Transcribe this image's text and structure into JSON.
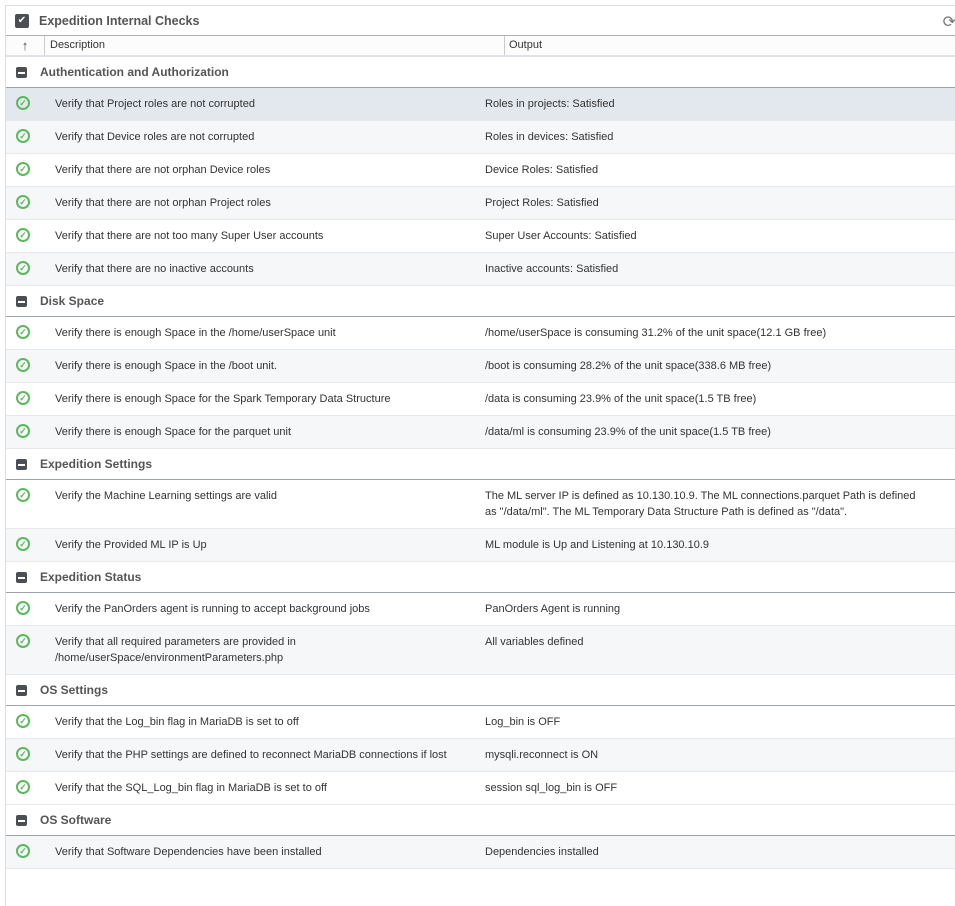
{
  "title": "Expedition Internal Checks",
  "columns": {
    "sort": "↑",
    "description": "Description",
    "output": "Output"
  },
  "groups": [
    {
      "name": "Authentication and Authorization",
      "rows": [
        {
          "description": "Verify that Project roles are not corrupted",
          "output": "Roles in projects: Satisfied"
        },
        {
          "description": "Verify that Device roles are not corrupted",
          "output": "Roles in devices: Satisfied"
        },
        {
          "description": "Verify that there are not orphan Device roles",
          "output": "Device Roles: Satisfied"
        },
        {
          "description": "Verify that there are not orphan Project roles",
          "output": "Project Roles: Satisfied"
        },
        {
          "description": "Verify that there are not too many Super User accounts",
          "output": "Super User Accounts: Satisfied"
        },
        {
          "description": "Verify that there are no inactive accounts",
          "output": "Inactive accounts: Satisfied"
        }
      ]
    },
    {
      "name": "Disk Space",
      "rows": [
        {
          "description": "Verify there is enough Space in the /home/userSpace unit",
          "output": "/home/userSpace is consuming 31.2% of the unit space(12.1 GB free)"
        },
        {
          "description": "Verify there is enough Space in the /boot unit.",
          "output": "/boot is consuming 28.2% of the unit space(338.6 MB free)"
        },
        {
          "description": "Verify there is enough Space for the Spark Temporary Data Structure",
          "output": "/data is consuming 23.9% of the unit space(1.5 TB free)"
        },
        {
          "description": "Verify there is enough Space for the parquet unit",
          "output": "/data/ml is consuming 23.9% of the unit space(1.5 TB free)"
        }
      ]
    },
    {
      "name": "Expedition Settings",
      "rows": [
        {
          "description": "Verify the Machine Learning settings are valid",
          "output": "The ML server IP is defined as 10.130.10.9. The ML connections.parquet Path is defined as \"/data/ml\". The ML Temporary Data Structure Path is defined as \"/data\"."
        },
        {
          "description": "Verify the Provided ML IP is Up",
          "output": "ML module is Up and Listening at 10.130.10.9"
        }
      ]
    },
    {
      "name": "Expedition Status",
      "rows": [
        {
          "description": "Verify the PanOrders agent is running to accept background jobs",
          "output": "PanOrders Agent is running"
        },
        {
          "description": "Verify that all required parameters are provided in /home/userSpace/environmentParameters.php",
          "output": "All variables defined"
        }
      ]
    },
    {
      "name": "OS Settings",
      "rows": [
        {
          "description": "Verify that the Log_bin flag in MariaDB is set to off",
          "output": "Log_bin is OFF"
        },
        {
          "description": "Verify that the PHP settings are defined to reconnect MariaDB connections if lost",
          "output": "mysqli.reconnect is ON"
        },
        {
          "description": "Verify that the SQL_Log_bin flag in MariaDB is set to off",
          "output": "session sql_log_bin is OFF"
        }
      ]
    },
    {
      "name": "OS Software",
      "rows": [
        {
          "description": "Verify that Software Dependencies have been installed",
          "output": "Dependencies installed"
        }
      ]
    }
  ]
}
